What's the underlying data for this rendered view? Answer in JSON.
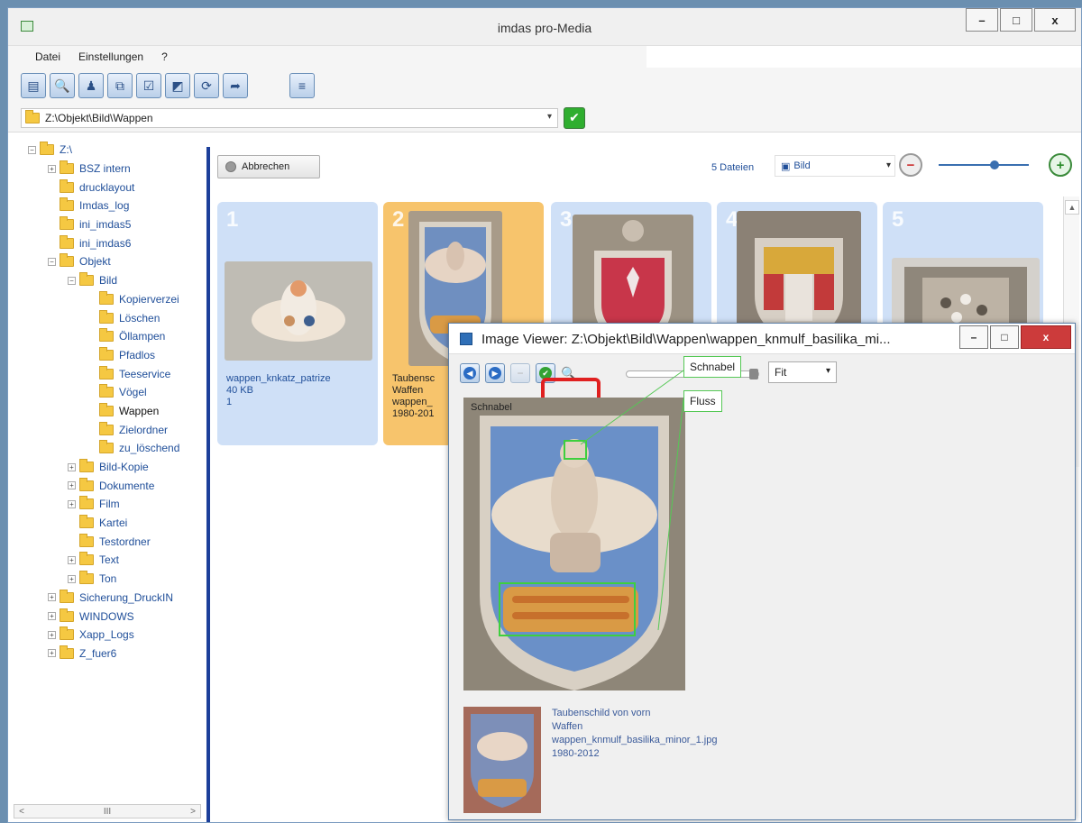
{
  "app": {
    "title": "imdas pro-Media",
    "window_buttons": [
      "–",
      "□",
      "x"
    ]
  },
  "menu": [
    "Datei",
    "Einstellungen",
    "?"
  ],
  "toolbar_icons": [
    "card-file-icon",
    "search-icon",
    "person-icon",
    "copy-icon",
    "checklist-icon",
    "map-icon",
    "refresh-icon",
    "export-icon",
    "list-icon"
  ],
  "path": {
    "value": "Z:\\Objekt\\Bild\\Wappen",
    "go_label": "✔"
  },
  "tree": [
    {
      "label": "Z:\\",
      "level": 0,
      "exp": "−"
    },
    {
      "label": "BSZ intern",
      "level": 1,
      "exp": "+"
    },
    {
      "label": "drucklayout",
      "level": 1,
      "exp": ""
    },
    {
      "label": "Imdas_log",
      "level": 1,
      "exp": ""
    },
    {
      "label": "ini_imdas5",
      "level": 1,
      "exp": ""
    },
    {
      "label": "ini_imdas6",
      "level": 1,
      "exp": ""
    },
    {
      "label": "Objekt",
      "level": 1,
      "exp": "−"
    },
    {
      "label": "Bild",
      "level": 2,
      "exp": "−"
    },
    {
      "label": "Kopierverzei",
      "level": 3,
      "exp": ""
    },
    {
      "label": "Löschen",
      "level": 3,
      "exp": ""
    },
    {
      "label": "Öllampen",
      "level": 3,
      "exp": ""
    },
    {
      "label": "Pfadlos",
      "level": 3,
      "exp": ""
    },
    {
      "label": "Teeservice",
      "level": 3,
      "exp": ""
    },
    {
      "label": "Vögel",
      "level": 3,
      "exp": ""
    },
    {
      "label": "Wappen",
      "level": 3,
      "exp": "",
      "selected": true
    },
    {
      "label": "Zielordner",
      "level": 3,
      "exp": ""
    },
    {
      "label": "zu_löschend",
      "level": 3,
      "exp": ""
    },
    {
      "label": "Bild-Kopie",
      "level": 2,
      "exp": "+"
    },
    {
      "label": "Dokumente",
      "level": 2,
      "exp": "+"
    },
    {
      "label": "Film",
      "level": 2,
      "exp": "+"
    },
    {
      "label": "Kartei",
      "level": 2,
      "exp": ""
    },
    {
      "label": "Testordner",
      "level": 2,
      "exp": ""
    },
    {
      "label": "Text",
      "level": 2,
      "exp": "+"
    },
    {
      "label": "Ton",
      "level": 2,
      "exp": "+"
    },
    {
      "label": "Sicherung_DruckIN",
      "level": 1,
      "exp": "+"
    },
    {
      "label": "WINDOWS",
      "level": 1,
      "exp": "+"
    },
    {
      "label": "Xapp_Logs",
      "level": 1,
      "exp": "+"
    },
    {
      "label": "Z_fuer6",
      "level": 1,
      "exp": "+"
    }
  ],
  "tree_scroll": {
    "left": "<",
    "mid": "III",
    "right": ">"
  },
  "gallery": {
    "cancel_label": "Abbrechen",
    "file_count": "5 Dateien",
    "view_value": "Bild",
    "zoom_out": "−",
    "zoom_in": "+",
    "zoom_level": 0.62,
    "cards": [
      {
        "num": "1",
        "name": "wappen_knkatz_patrize",
        "size": "40 KB",
        "extra": "1",
        "selected": false
      },
      {
        "num": "2",
        "name": "Taubensc",
        "line2": "Waffen",
        "line3": "wappen_",
        "line4": "1980-201",
        "selected": true
      },
      {
        "num": "3",
        "selected": false
      },
      {
        "num": "4",
        "selected": false
      },
      {
        "num": "5",
        "selected": false
      }
    ]
  },
  "viewer": {
    "title": "Image Viewer: Z:\\Objekt\\Bild\\Wappen\\wappen_knmulf_basilika_mi...",
    "window_buttons": [
      "–",
      "□",
      "x"
    ],
    "fit_value": "Fit",
    "zoom_level": 0.95,
    "tags": [
      "Schnabel",
      "Fluss"
    ],
    "overlay_text": "Schnabel",
    "info": [
      "Taubenschild von vorn",
      "Waffen",
      "wappen_knmulf_basilika_minor_1.jpg",
      "1980-2012"
    ]
  },
  "colors": {
    "accent_blue": "#1c3f9a",
    "card_bg": "#cfe0f7",
    "card_selected": "#f7c46c",
    "highlight": "#e02020",
    "tag_green": "#55c855"
  }
}
